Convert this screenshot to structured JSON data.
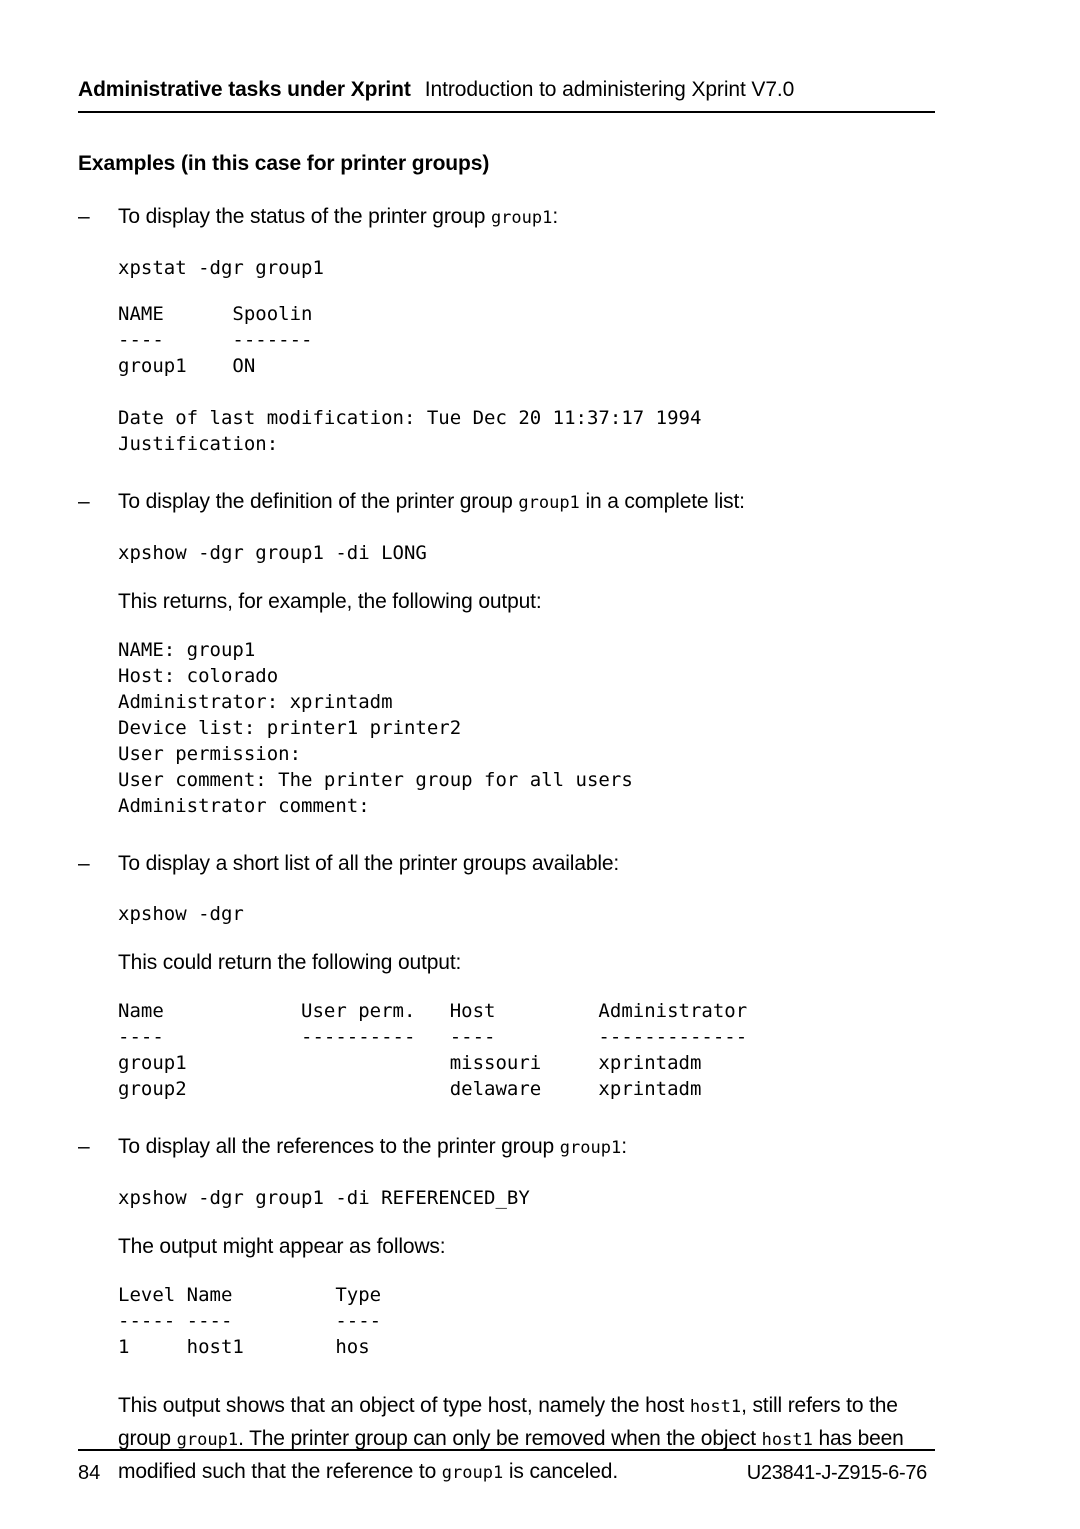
{
  "header": {
    "left": "Administrative tasks under Xprint",
    "right": "Introduction to administering Xprint V7.0"
  },
  "section_title": "Examples (in this case for printer groups)",
  "blocks": {
    "b1_bullet_pre": "To display the status of the printer group ",
    "b1_bullet_code": "group1",
    "b1_bullet_post": ":",
    "b1_command": "xpstat -dgr group1",
    "b1_output": "NAME      Spoolin\n----      -------\ngroup1    ON\n\nDate of last modification: Tue Dec 20 11:37:17 1994\nJustification:",
    "b2_bullet_pre": "To display the definition of the printer group ",
    "b2_bullet_code": "group1",
    "b2_bullet_post": " in a complete list:",
    "b2_command": "xpshow -dgr group1 -di LONG",
    "b2_intro": "This returns, for example, the following output:",
    "b2_output": "NAME: group1\nHost: colorado\nAdministrator: xprintadm\nDevice list: printer1 printer2\nUser permission:\nUser comment: The printer group for all users\nAdministrator comment:",
    "b3_bullet": "To display a short list of all the printer groups available:",
    "b3_command": "xpshow -dgr",
    "b3_intro": "This could return the following output:",
    "b3_output": "Name            User perm.   Host         Administrator\n----            ----------   ----         -------------\ngroup1                       missouri     xprintadm\ngroup2                       delaware     xprintadm",
    "b4_bullet_pre": "To display all the references to the printer group ",
    "b4_bullet_code": "group1",
    "b4_bullet_post": ":",
    "b4_command": "xpshow -dgr group1 -di REFERENCED_BY",
    "b4_intro": "The output might appear as follows:",
    "b4_output": "Level Name         Type\n----- ----         ----\n1     host1        hos",
    "closing_1": "This output shows that an object of type host, namely the host ",
    "closing_code_1": "host1",
    "closing_2": ", still refers to the group ",
    "closing_code_2": "group1",
    "closing_3": ". The printer group can only be removed when the object ",
    "closing_code_3": "host1",
    "closing_4": " has been modified such that the reference to ",
    "closing_code_4": "group1",
    "closing_5": " is canceled."
  },
  "tables": {
    "xpstat_status": {
      "columns": [
        "NAME",
        "Spoolin"
      ],
      "rows": [
        [
          "group1",
          "ON"
        ]
      ],
      "extra_lines": [
        "Date of last modification: Tue Dec 20 11:37:17 1994",
        "Justification:"
      ]
    },
    "group_definition": {
      "fields": [
        {
          "label": "NAME",
          "value": "group1"
        },
        {
          "label": "Host",
          "value": "colorado"
        },
        {
          "label": "Administrator",
          "value": "xprintadm"
        },
        {
          "label": "Device list",
          "value": "printer1 printer2"
        },
        {
          "label": "User permission",
          "value": ""
        },
        {
          "label": "User comment",
          "value": "The printer group for all users"
        },
        {
          "label": "Administrator comment",
          "value": ""
        }
      ]
    },
    "group_short_list": {
      "columns": [
        "Name",
        "User perm.",
        "Host",
        "Administrator"
      ],
      "rows": [
        [
          "group1",
          "",
          "missouri",
          "xprintadm"
        ],
        [
          "group2",
          "",
          "delaware",
          "xprintadm"
        ]
      ]
    },
    "referenced_by": {
      "columns": [
        "Level",
        "Name",
        "Type"
      ],
      "rows": [
        [
          "1",
          "host1",
          "hos"
        ]
      ]
    }
  },
  "footer": {
    "page_number": "84",
    "document_id": "U23841-J-Z915-6-76"
  }
}
